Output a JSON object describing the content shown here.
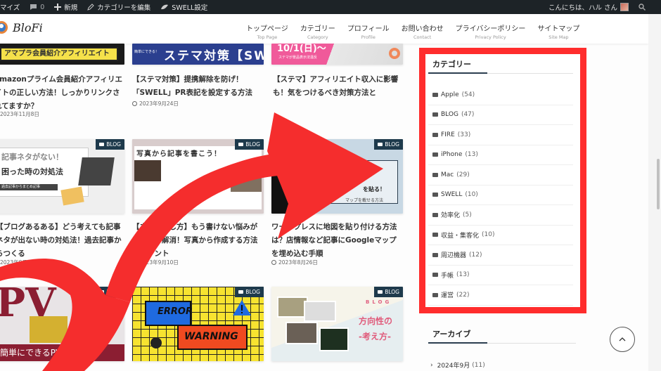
{
  "adminbar": {
    "customize": "マイズ",
    "comments_count": "0",
    "new_label": "新規",
    "edit_category": "カテゴリーを編集",
    "swell_settings": "SWELL設定",
    "greeting": "こんにちは、ハル さん"
  },
  "header": {
    "logo_text": "BloFi",
    "nav": [
      {
        "jp": "トップページ",
        "en": "Top Page"
      },
      {
        "jp": "カテゴリー",
        "en": "Category"
      },
      {
        "jp": "プロフィール",
        "en": "Profile"
      },
      {
        "jp": "お問い合わせ",
        "en": "Contact"
      },
      {
        "jp": "プライバシーポリシー",
        "en": "Privacy Policy"
      },
      {
        "jp": "サイトマップ",
        "en": "Site Map"
      }
    ]
  },
  "posts": [
    {
      "thumb_text": "アマプラ会員紹介アフィリエイト",
      "title": "amazonプライム会員紹介アフィリエイトの正しい方法！しっかりリンクされてますか？",
      "date": "2023年11月8日"
    },
    {
      "thumb_text": "ステマ対策【SWELL",
      "thumb_sub": "簡単にできる！",
      "title": "【ステマ対策】提携解除を防げ！「SWELL」PR表記を設定する方法",
      "date": "2023年9月24日"
    },
    {
      "thumb_text": "10/1(日)〜",
      "thumb_sub": "ステマが景品表示法違反",
      "title": "【ステマ】アフィリエイト収入に影響も！気をつけるべき対策方法と",
      "date": ""
    },
    {
      "badge": "BLOG",
      "thumb_text": "記事ネタがない！",
      "thumb_text2": "困った時の対処法",
      "thumb_sub": "過去記事からまとめ記事",
      "title": "【ブログあるある】どう考えても記事ネタが出ない時の対処法！過去記事からつくる",
      "date": "2023年9月17日"
    },
    {
      "badge": "BLOG",
      "thumb_text": "写真から記事を書こう！",
      "title": "【ネタの探し方】もう書けない悩みがスッキリ解消！写真から作成する方法とポイント",
      "date": "2023年9月10日"
    },
    {
      "badge": "BLOG",
      "thumb_text": "を貼る！",
      "thumb_sub": "マップを載せる方法",
      "title": "ワードプレスに地図を貼り付ける方法は？店情報など記事にGoogleマップを埋め込む手順",
      "date": "2023年8月26日"
    },
    {
      "badge": "BLOG",
      "thumb_text": "簡単にできるPV数非表示"
    },
    {
      "badge": "BLOG",
      "thumb_text": "ERROR",
      "thumb_text2": "WARNING"
    },
    {
      "badge": "BLOG",
      "thumb_text": "方向性の",
      "thumb_text2": "-考え方-",
      "thumb_sub": "BLOG"
    }
  ],
  "sidebar": {
    "category_title": "カテゴリー",
    "categories": [
      {
        "name": "Apple",
        "count": "(54)"
      },
      {
        "name": "BLOG",
        "count": "(47)"
      },
      {
        "name": "FIRE",
        "count": "(33)"
      },
      {
        "name": "iPhone",
        "count": "(13)"
      },
      {
        "name": "Mac",
        "count": "(29)"
      },
      {
        "name": "SWELL",
        "count": "(10)"
      },
      {
        "name": "効率化",
        "count": "(5)"
      },
      {
        "name": "収益・集客化",
        "count": "(10)"
      },
      {
        "name": "周辺機器",
        "count": "(12)"
      },
      {
        "name": "手帳",
        "count": "(13)"
      },
      {
        "name": "運営",
        "count": "(22)"
      }
    ],
    "archive_title": "アーカイブ",
    "archives": [
      {
        "label": "2024年9月",
        "count": "(11)"
      }
    ]
  },
  "colors": {
    "highlight": "#ff2d2d",
    "badge": "#1e3a4c",
    "adminbar": "#1d2327"
  }
}
